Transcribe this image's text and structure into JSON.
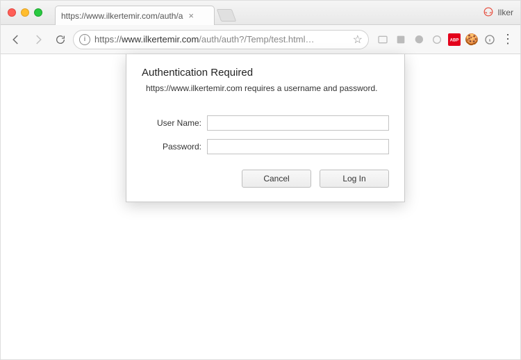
{
  "window": {
    "profile_name": "Ilker"
  },
  "tab": {
    "title": "https://www.ilkertemir.com/auth/a"
  },
  "omnibox": {
    "scheme": "https",
    "domain": "www.ilkertemir.com",
    "path_display": "/auth/auth?/Temp/test.html…"
  },
  "extensions": {
    "abp_label": "ABP"
  },
  "dialog": {
    "title": "Authentication Required",
    "message": "https://www.ilkertemir.com requires a username and password.",
    "username_label": "User Name:",
    "password_label": "Password:",
    "username_value": "",
    "password_value": "",
    "cancel_label": "Cancel",
    "login_label": "Log In"
  }
}
